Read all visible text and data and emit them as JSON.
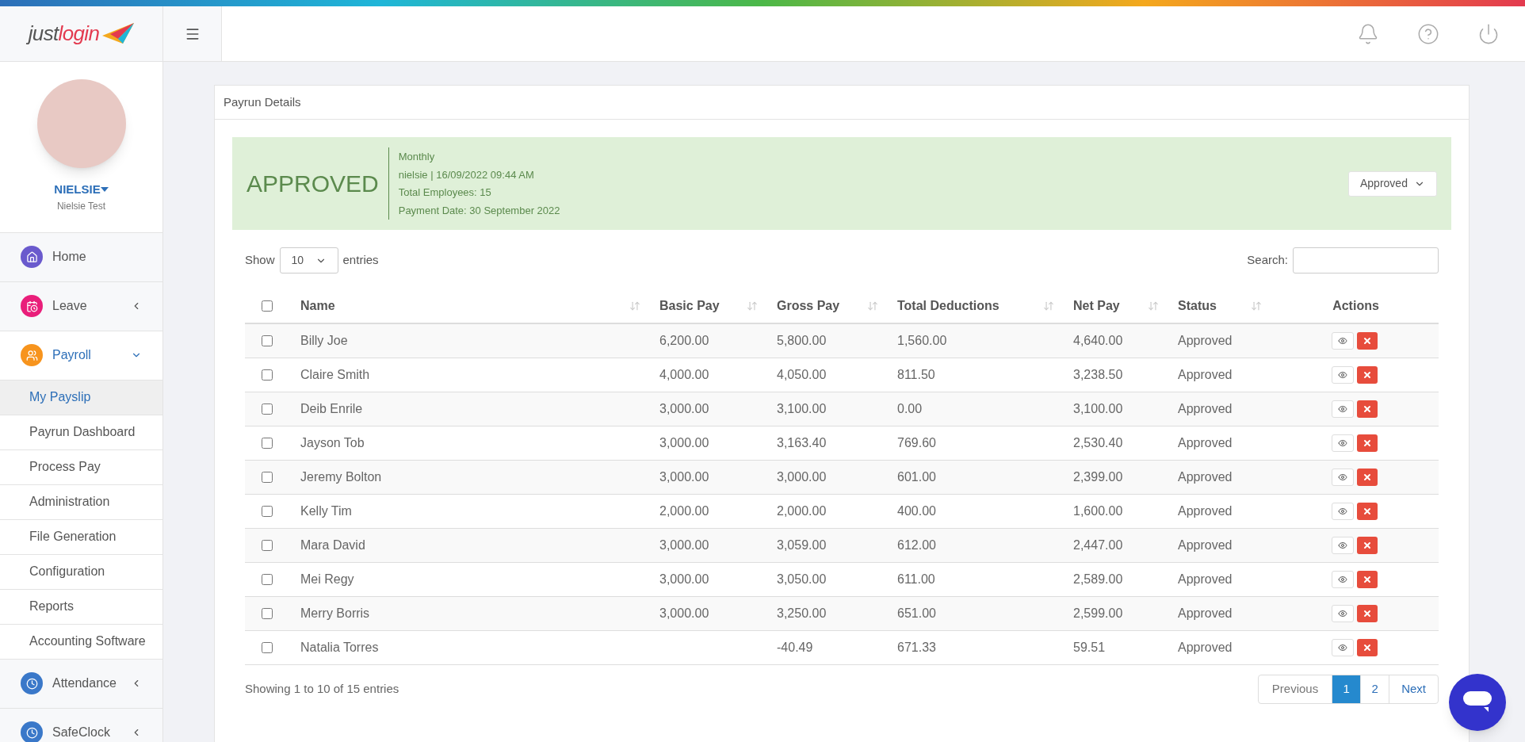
{
  "logo": {
    "part_1": "just",
    "part_2": "login"
  },
  "user": {
    "username": "NIELSIE",
    "full_name": "Nielsie Test"
  },
  "sidebar": {
    "items": [
      {
        "label": "Home",
        "kind": "home",
        "color": "#6a5acd",
        "expanded": false,
        "has_caret": false
      },
      {
        "label": "Leave",
        "kind": "calendar",
        "color": "#e91e7a",
        "expanded": false,
        "has_caret": true
      },
      {
        "label": "Payroll",
        "kind": "users",
        "color": "#f7941d",
        "expanded": true,
        "has_caret": true,
        "children": [
          {
            "label": "My Payslip",
            "selected": true
          },
          {
            "label": "Payrun Dashboard",
            "selected": false
          },
          {
            "label": "Process Pay",
            "selected": false
          },
          {
            "label": "Administration",
            "selected": false
          },
          {
            "label": "File Generation",
            "selected": false
          },
          {
            "label": "Configuration",
            "selected": false
          },
          {
            "label": "Reports",
            "selected": false
          },
          {
            "label": "Accounting Software",
            "selected": false
          }
        ]
      },
      {
        "label": "Attendance",
        "kind": "clock",
        "color": "#3a78c9",
        "expanded": false,
        "has_caret": true
      },
      {
        "label": "SafeClock",
        "kind": "clock",
        "color": "#3a78c9",
        "expanded": false,
        "has_caret": true
      }
    ]
  },
  "card": {
    "title": "Payrun Details",
    "banner": {
      "status": "APPROVED",
      "lines": [
        "Monthly",
        "nielsie | 16/09/2022 09:44 AM",
        "Total Employees: 15",
        "Payment Date: 30 September 2022"
      ],
      "status_select": "Approved"
    },
    "length_menu": {
      "before": "Show",
      "value": "10",
      "after": "entries"
    },
    "search": {
      "label": "Search:"
    },
    "table": {
      "select_all_checked": false,
      "columns": [
        {
          "label": "Name",
          "sortable": true
        },
        {
          "label": "Basic Pay",
          "sortable": true
        },
        {
          "label": "Gross Pay",
          "sortable": true
        },
        {
          "label": "Total Deductions",
          "sortable": true
        },
        {
          "label": "Net Pay",
          "sortable": true
        },
        {
          "label": "Status",
          "sortable": true
        },
        {
          "label": "Actions",
          "sortable": false
        }
      ],
      "rows": [
        {
          "checked": false,
          "cells": [
            "Billy Joe",
            "6,200.00",
            "5,800.00",
            "1,560.00",
            "4,640.00",
            "Approved"
          ]
        },
        {
          "checked": false,
          "cells": [
            "Claire Smith",
            "4,000.00",
            "4,050.00",
            "811.50",
            "3,238.50",
            "Approved"
          ]
        },
        {
          "checked": false,
          "cells": [
            "Deib Enrile",
            "3,000.00",
            "3,100.00",
            "0.00",
            "3,100.00",
            "Approved"
          ]
        },
        {
          "checked": false,
          "cells": [
            "Jayson Tob",
            "3,000.00",
            "3,163.40",
            "769.60",
            "2,530.40",
            "Approved"
          ]
        },
        {
          "checked": false,
          "cells": [
            "Jeremy Bolton",
            "3,000.00",
            "3,000.00",
            "601.00",
            "2,399.00",
            "Approved"
          ]
        },
        {
          "checked": false,
          "cells": [
            "Kelly Tim",
            "2,000.00",
            "2,000.00",
            "400.00",
            "1,600.00",
            "Approved"
          ]
        },
        {
          "checked": false,
          "cells": [
            "Mara David",
            "3,000.00",
            "3,059.00",
            "612.00",
            "2,447.00",
            "Approved"
          ]
        },
        {
          "checked": false,
          "cells": [
            "Mei Regy",
            "3,000.00",
            "3,050.00",
            "611.00",
            "2,589.00",
            "Approved"
          ]
        },
        {
          "checked": false,
          "cells": [
            "Merry Borris",
            "3,000.00",
            "3,250.00",
            "651.00",
            "2,599.00",
            "Approved"
          ]
        },
        {
          "checked": false,
          "cells": [
            "Natalia Torres",
            null,
            "-40.49",
            "671.33",
            "59.51",
            "Approved"
          ]
        }
      ]
    },
    "info": "Showing 1 to 10 of 15 entries",
    "pagination": {
      "previous": "Previous",
      "next": "Next",
      "pages": [
        {
          "label": "1",
          "selected": true
        },
        {
          "label": "2",
          "selected": false
        }
      ]
    }
  }
}
